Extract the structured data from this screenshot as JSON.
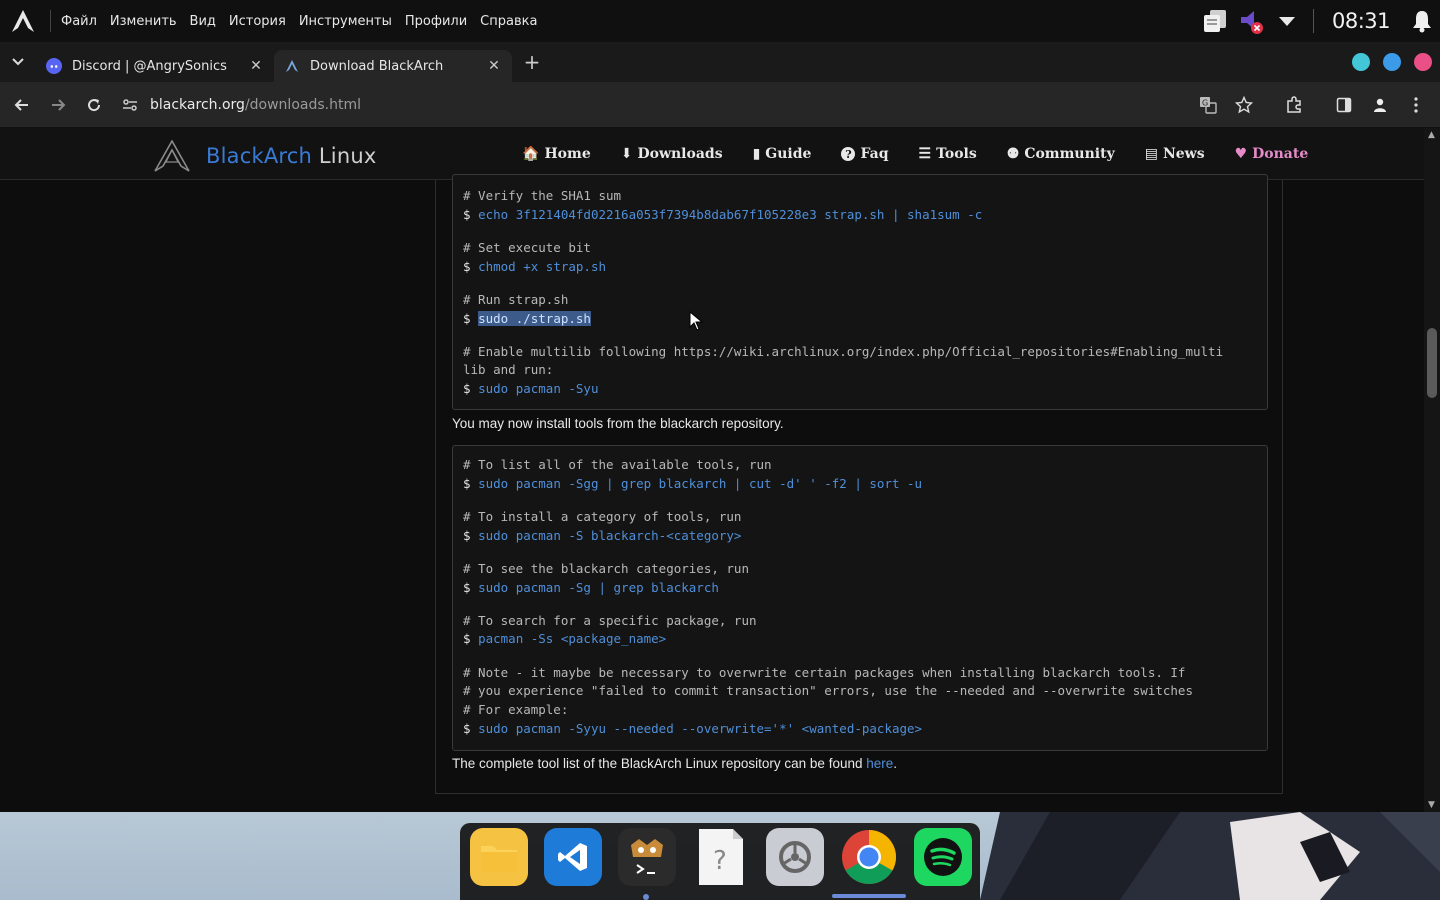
{
  "system_bar": {
    "menu": [
      "Файл",
      "Изменить",
      "Вид",
      "История",
      "Инструменты",
      "Профили",
      "Справка"
    ],
    "clock": "08:31"
  },
  "tabs": [
    {
      "title": "Discord | @AngrySonics",
      "icon": "discord-icon",
      "active": false
    },
    {
      "title": "Download BlackArch",
      "icon": "blackarch-icon",
      "active": true
    }
  ],
  "address": {
    "host": "blackarch.org",
    "path": "/downloads.html"
  },
  "site": {
    "logo_brand": "BlackArch",
    "logo_suffix": " Linux",
    "nav": [
      {
        "icon": "home-icon",
        "glyph": "🏠",
        "label": "Home"
      },
      {
        "icon": "download-icon",
        "glyph": "⬇",
        "label": "Downloads"
      },
      {
        "icon": "book-icon",
        "glyph": "📕",
        "label": "Guide"
      },
      {
        "icon": "question-icon",
        "glyph": "?",
        "label": "Faq"
      },
      {
        "icon": "list-icon",
        "glyph": "☰",
        "label": "Tools"
      },
      {
        "icon": "users-icon",
        "glyph": "👥",
        "label": "Community"
      },
      {
        "icon": "newspaper-icon",
        "glyph": "▤",
        "label": "News"
      },
      {
        "icon": "heart-icon",
        "glyph": "♥",
        "label": "Donate"
      }
    ]
  },
  "code1": {
    "c1": "# Verify the SHA1 sum",
    "l1": "echo 3f121404fd02216a053f7394b8dab67f105228e3 strap.sh | sha1sum -c",
    "c2": "# Set execute bit",
    "l2": "chmod +x strap.sh",
    "c3": "# Run strap.sh",
    "l3": "sudo ./strap.sh",
    "c4a": "# Enable multilib following https://wiki.archlinux.org/index.php/Official_repositories#Enabling_multi",
    "c4b": "lib and run:",
    "l4": "sudo pacman -Syu"
  },
  "para1": "You may now install tools from the blackarch repository.",
  "code2": {
    "c1": "# To list all of the available tools, run",
    "l1": "sudo pacman -Sgg | grep blackarch | cut -d' ' -f2 | sort -u",
    "c2": "# To install a category of tools, run",
    "l2": "sudo pacman -S blackarch-<category>",
    "c3": "# To see the blackarch categories, run",
    "l3": "sudo pacman -Sg | grep blackarch",
    "c4": "# To search for a specific package, run",
    "l4": "pacman -Ss <package_name>",
    "c5a": "# Note - it maybe be necessary to overwrite certain packages when installing blackarch tools. If",
    "c5b": "# you experience \"failed to commit transaction\" errors, use the --needed and --overwrite switches",
    "c5c": "# For example:",
    "l5": "sudo pacman -Syyu --needed --overwrite='*' <wanted-package>"
  },
  "prompt": "$",
  "para2": {
    "text": "The complete tool list of the BlackArch Linux repository can be found ",
    "link": "here",
    "end": "."
  },
  "dock": [
    "files-icon",
    "vscode-icon",
    "terminal-icon",
    "unknown-app-icon",
    "settings-icon",
    "chrome-icon",
    "spotify-icon"
  ],
  "colors": {
    "accent_blue": "#4f8fd9",
    "donate_pink": "#e58bc9",
    "selection": "#3d5b8a"
  }
}
